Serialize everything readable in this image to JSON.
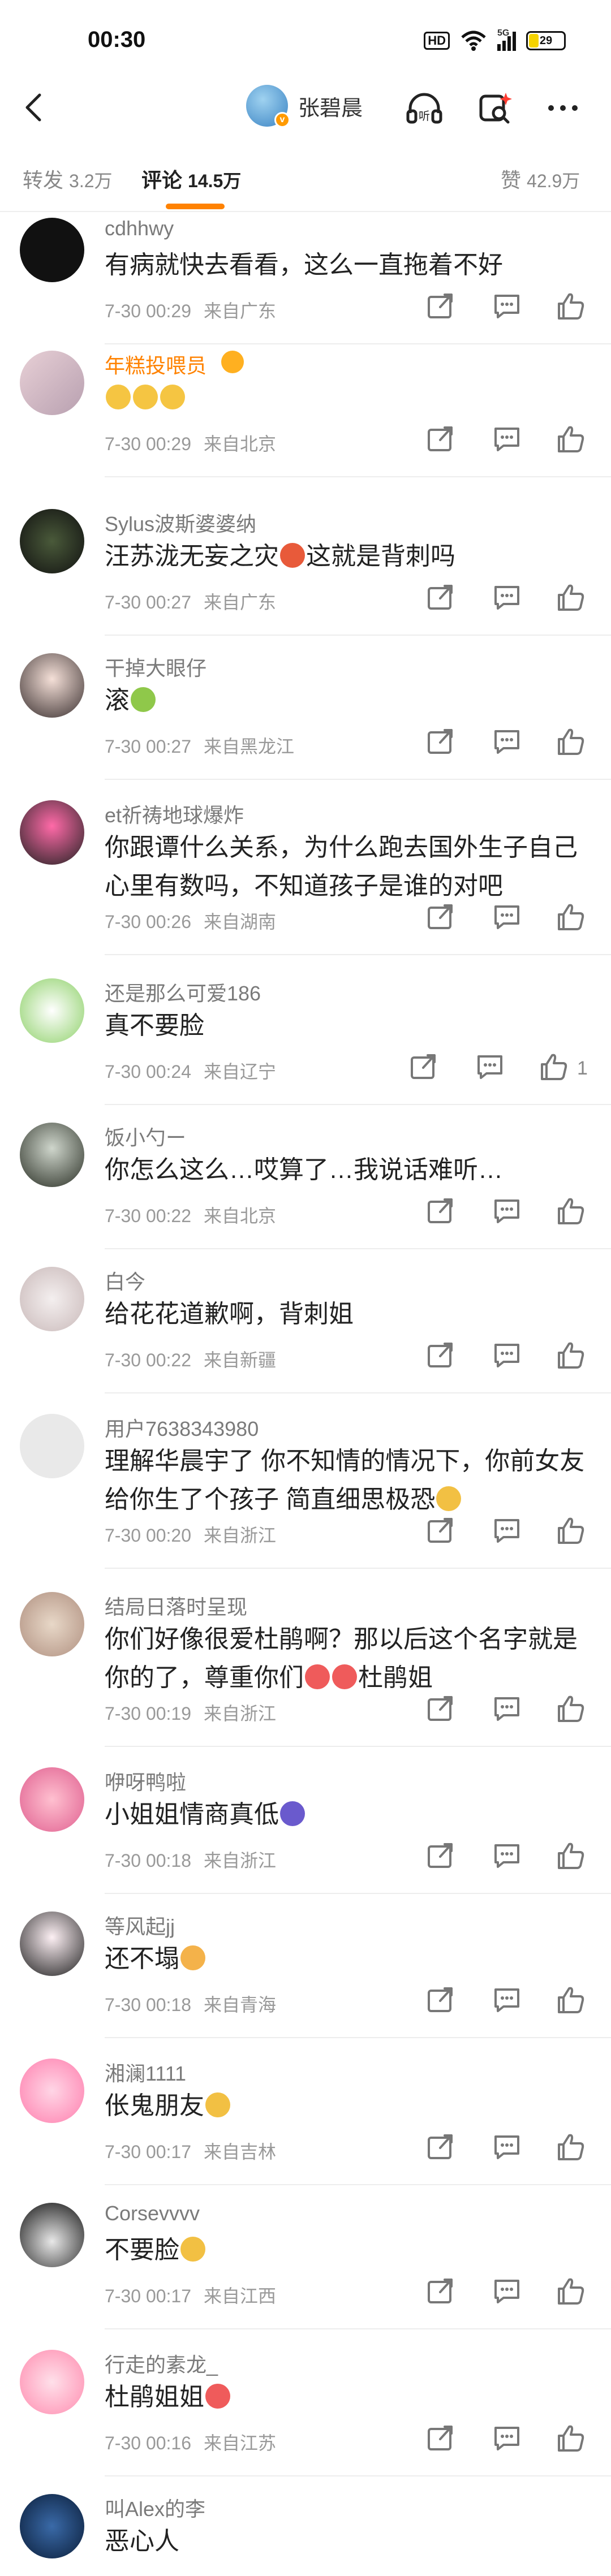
{
  "status_bar": {
    "time": "00:30",
    "hd": "HD",
    "signal": "5G",
    "battery": "29"
  },
  "nav": {
    "username": "张碧晨"
  },
  "tabs": [
    {
      "label": "转发",
      "count": "3.2万"
    },
    {
      "label": "评论",
      "count": "14.5万"
    },
    {
      "label": "赞",
      "count": "42.9万"
    }
  ],
  "comments": [
    {
      "name": "cdhhwy",
      "text": "有病就快去看看，这么一直拖着不好",
      "time": "7-30 00:29",
      "location": "来自广东"
    },
    {
      "name": "年糕投喂员",
      "text": "",
      "time": "7-30 00:29",
      "location": "来自北京"
    },
    {
      "name": "Sylus波斯婆婆纳",
      "text": "汪苏泷无妄之灾",
      "text_after": "这就是背刺吗",
      "time": "7-30 00:27",
      "location": "来自广东"
    },
    {
      "name": "干掉大眼仔",
      "text": "滚",
      "time": "7-30 00:27",
      "location": "来自黑龙江"
    },
    {
      "name": "et祈祷地球爆炸",
      "text": "你跟谭什么关系，为什么跑去国外生子自己心里有数吗，不知道孩子是谁的对吧",
      "time": "7-30 00:26",
      "location": "来自湖南"
    },
    {
      "name": "还是那么可爱186",
      "text": "真不要脸",
      "time": "7-30 00:24",
      "location": "来自辽宁",
      "likes": "1"
    },
    {
      "name": "饭小勺ー",
      "text": "你怎么这么…哎算了…我说话难听…",
      "time": "7-30 00:22",
      "location": "来自北京"
    },
    {
      "name": "白今",
      "text": "给花花道歉啊，背刺姐",
      "time": "7-30 00:22",
      "location": "来自新疆"
    },
    {
      "name": "用户7638343980",
      "text": "理解华晨宇了 你不知情的情况下，你前女友给你生了个孩子  简直细思极恐",
      "time": "7-30 00:20",
      "location": "来自浙江"
    },
    {
      "name": "结局日落时呈现",
      "text": "你们好像很爱杜鹃啊？那以后这个名字就是你的了，尊重你们",
      "text_after": "杜鹃姐",
      "time": "7-30 00:19",
      "location": "来自浙江"
    },
    {
      "name": "咿呀鸭啦",
      "text": "小姐姐情商真低",
      "time": "7-30 00:18",
      "location": "来自浙江"
    },
    {
      "name": "等风起jj",
      "text": "还不塌",
      "time": "7-30 00:18",
      "location": "来自青海"
    },
    {
      "name": "湘澜1111",
      "text": "伥鬼朋友",
      "time": "7-30 00:17",
      "location": "来自吉林"
    },
    {
      "name": "Corsevvvv",
      "text": "不要脸",
      "time": "7-30 00:17",
      "location": "来自江西"
    },
    {
      "name": "行走的素龙_",
      "text": "杜鹃姐姐",
      "time": "7-30 00:16",
      "location": "来自江苏"
    },
    {
      "name": "叫Alex的李",
      "text": "恶心人"
    }
  ],
  "colors": {
    "accent": "#ff8200",
    "text": "#222222",
    "meta": "#999999"
  }
}
